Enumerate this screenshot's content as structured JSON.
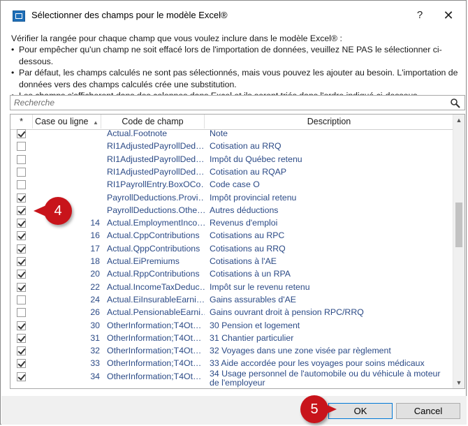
{
  "window": {
    "title": "Sélectionner des champs pour le modèle Excel®",
    "help": "?",
    "close": "✕"
  },
  "instructions": {
    "intro": "Vérifier la rangée pour chaque champ que vous voulez inclure dans le modèle Excel® :",
    "bullets": [
      "Pour empêcher qu'un champ ne soit effacé lors de l'importation de données, veuillez NE PAS le sélectionner ci-dessous.",
      "Par défaut, les champs calculés ne sont pas sélectionnés, mais vous pouvez les ajouter au besoin. L'importation de données vers des champs calculés crée une substitution.",
      "Les champs s'afficheront dans des colonnes dans Excel et ils seront triés dans l'ordre indiqué ci-dessous."
    ]
  },
  "search": {
    "placeholder": "Recherche",
    "icon": "search-icon"
  },
  "grid": {
    "headers": {
      "select": "*",
      "case": "Case ou ligne",
      "sort_icon": "▲",
      "code": "Code de champ",
      "description": "Description"
    },
    "rows": [
      {
        "checked": true,
        "num": "",
        "code": "Actual.Footnote",
        "desc": "Note"
      },
      {
        "checked": false,
        "num": "",
        "code": "RI1AdjustedPayrollDed…",
        "desc": "Cotisation au RRQ"
      },
      {
        "checked": false,
        "num": "",
        "code": "RI1AdjustedPayrollDed…",
        "desc": "Impôt du Québec retenu"
      },
      {
        "checked": false,
        "num": "",
        "code": "RI1AdjustedPayrollDed…",
        "desc": "Cotisation au RQAP"
      },
      {
        "checked": false,
        "num": "",
        "code": "RI1PayrollEntry.BoxOCo…",
        "desc": "Code case O"
      },
      {
        "checked": true,
        "num": "",
        "code": "PayrollDeductions.Provi…",
        "desc": "Impôt provincial retenu"
      },
      {
        "checked": true,
        "num": "",
        "code": "PayrollDeductions.Othe…",
        "desc": "Autres déductions"
      },
      {
        "checked": true,
        "num": "14",
        "code": "Actual.EmploymentInco…",
        "desc": "Revenus d'emploi"
      },
      {
        "checked": true,
        "num": "16",
        "code": "Actual.CppContributions",
        "desc": "Cotisations au RPC"
      },
      {
        "checked": true,
        "num": "17",
        "code": "Actual.QppContributions",
        "desc": "Cotisations au RRQ"
      },
      {
        "checked": true,
        "num": "18",
        "code": "Actual.EiPremiums",
        "desc": "Cotisations à l'AE"
      },
      {
        "checked": true,
        "num": "20",
        "code": "Actual.RppContributions",
        "desc": "Cotisations à un RPA"
      },
      {
        "checked": true,
        "num": "22",
        "code": "Actual.IncomeTaxDeduc…",
        "desc": "Impôt sur le revenu retenu"
      },
      {
        "checked": false,
        "num": "24",
        "code": "Actual.EiInsurableEarni…",
        "desc": "Gains assurables d'AE"
      },
      {
        "checked": false,
        "num": "26",
        "code": "Actual.PensionableEarni…",
        "desc": "Gains ouvrant droit à pension RPC/RRQ"
      },
      {
        "checked": true,
        "num": "30",
        "code": "OtherInformation;T4Ot…",
        "desc": "30 Pension et logement"
      },
      {
        "checked": true,
        "num": "31",
        "code": "OtherInformation;T4Ot…",
        "desc": "31 Chantier particulier"
      },
      {
        "checked": true,
        "num": "32",
        "code": "OtherInformation;T4Ot…",
        "desc": "32 Voyages dans une zone visée par règlement"
      },
      {
        "checked": true,
        "num": "33",
        "code": "OtherInformation;T4Ot…",
        "desc": "33 Aide accordée pour les voyages pour soins médicaux"
      },
      {
        "checked": true,
        "num": "34",
        "code": "OtherInformation;T4Ot…",
        "desc": "34 Usage personnel de l'automobile ou du véhicule à moteur de l'employeur"
      }
    ],
    "scroll_up": "▲",
    "scroll_down": "▼"
  },
  "footer": {
    "ok": "OK",
    "cancel": "Cancel"
  },
  "callouts": {
    "step4": "4",
    "step5": "5"
  },
  "colors": {
    "callout": "#c8141b",
    "link_text": "#2b4a86",
    "footer_bg": "#f0f0f0"
  }
}
